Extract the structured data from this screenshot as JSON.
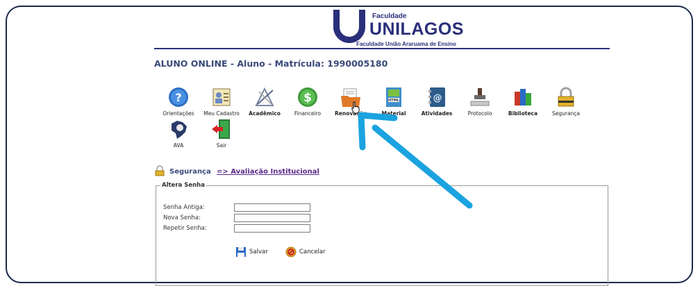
{
  "header": {
    "logo_faculdade": "Faculdade",
    "logo_name": "UNILAGOS",
    "logo_subtitle": "Faculdade União Araruama de Ensino"
  },
  "student": {
    "line": "ALUNO ONLINE - Aluno - Matrícula: 1990005180"
  },
  "menu": {
    "orientacoes": "Orientações",
    "meu_cadastro": "Meu Cadastro",
    "academico": "Acadêmico",
    "financeiro": "Financeiro",
    "renovacao": "Renovação",
    "material": "Material",
    "atividades": "Atividades",
    "protocolo": "Protocolo",
    "biblioteca": "Biblioteca",
    "seguranca": "Segurança",
    "ava": "AVA",
    "sair": "Sair"
  },
  "breadcrumb": {
    "section": "Segurança",
    "link": "=> Avaliação Institucional"
  },
  "password_form": {
    "legend": "Altera Senha",
    "old_label": "Senha Antiga:",
    "new_label": "Nova Senha:",
    "repeat_label": "Repetir Senha:",
    "old_value": "",
    "new_value": "",
    "repeat_value": "",
    "save_label": "Salvar",
    "cancel_label": "Cancelar"
  },
  "annotation": {
    "arrow_color": "#1aa3e0"
  }
}
